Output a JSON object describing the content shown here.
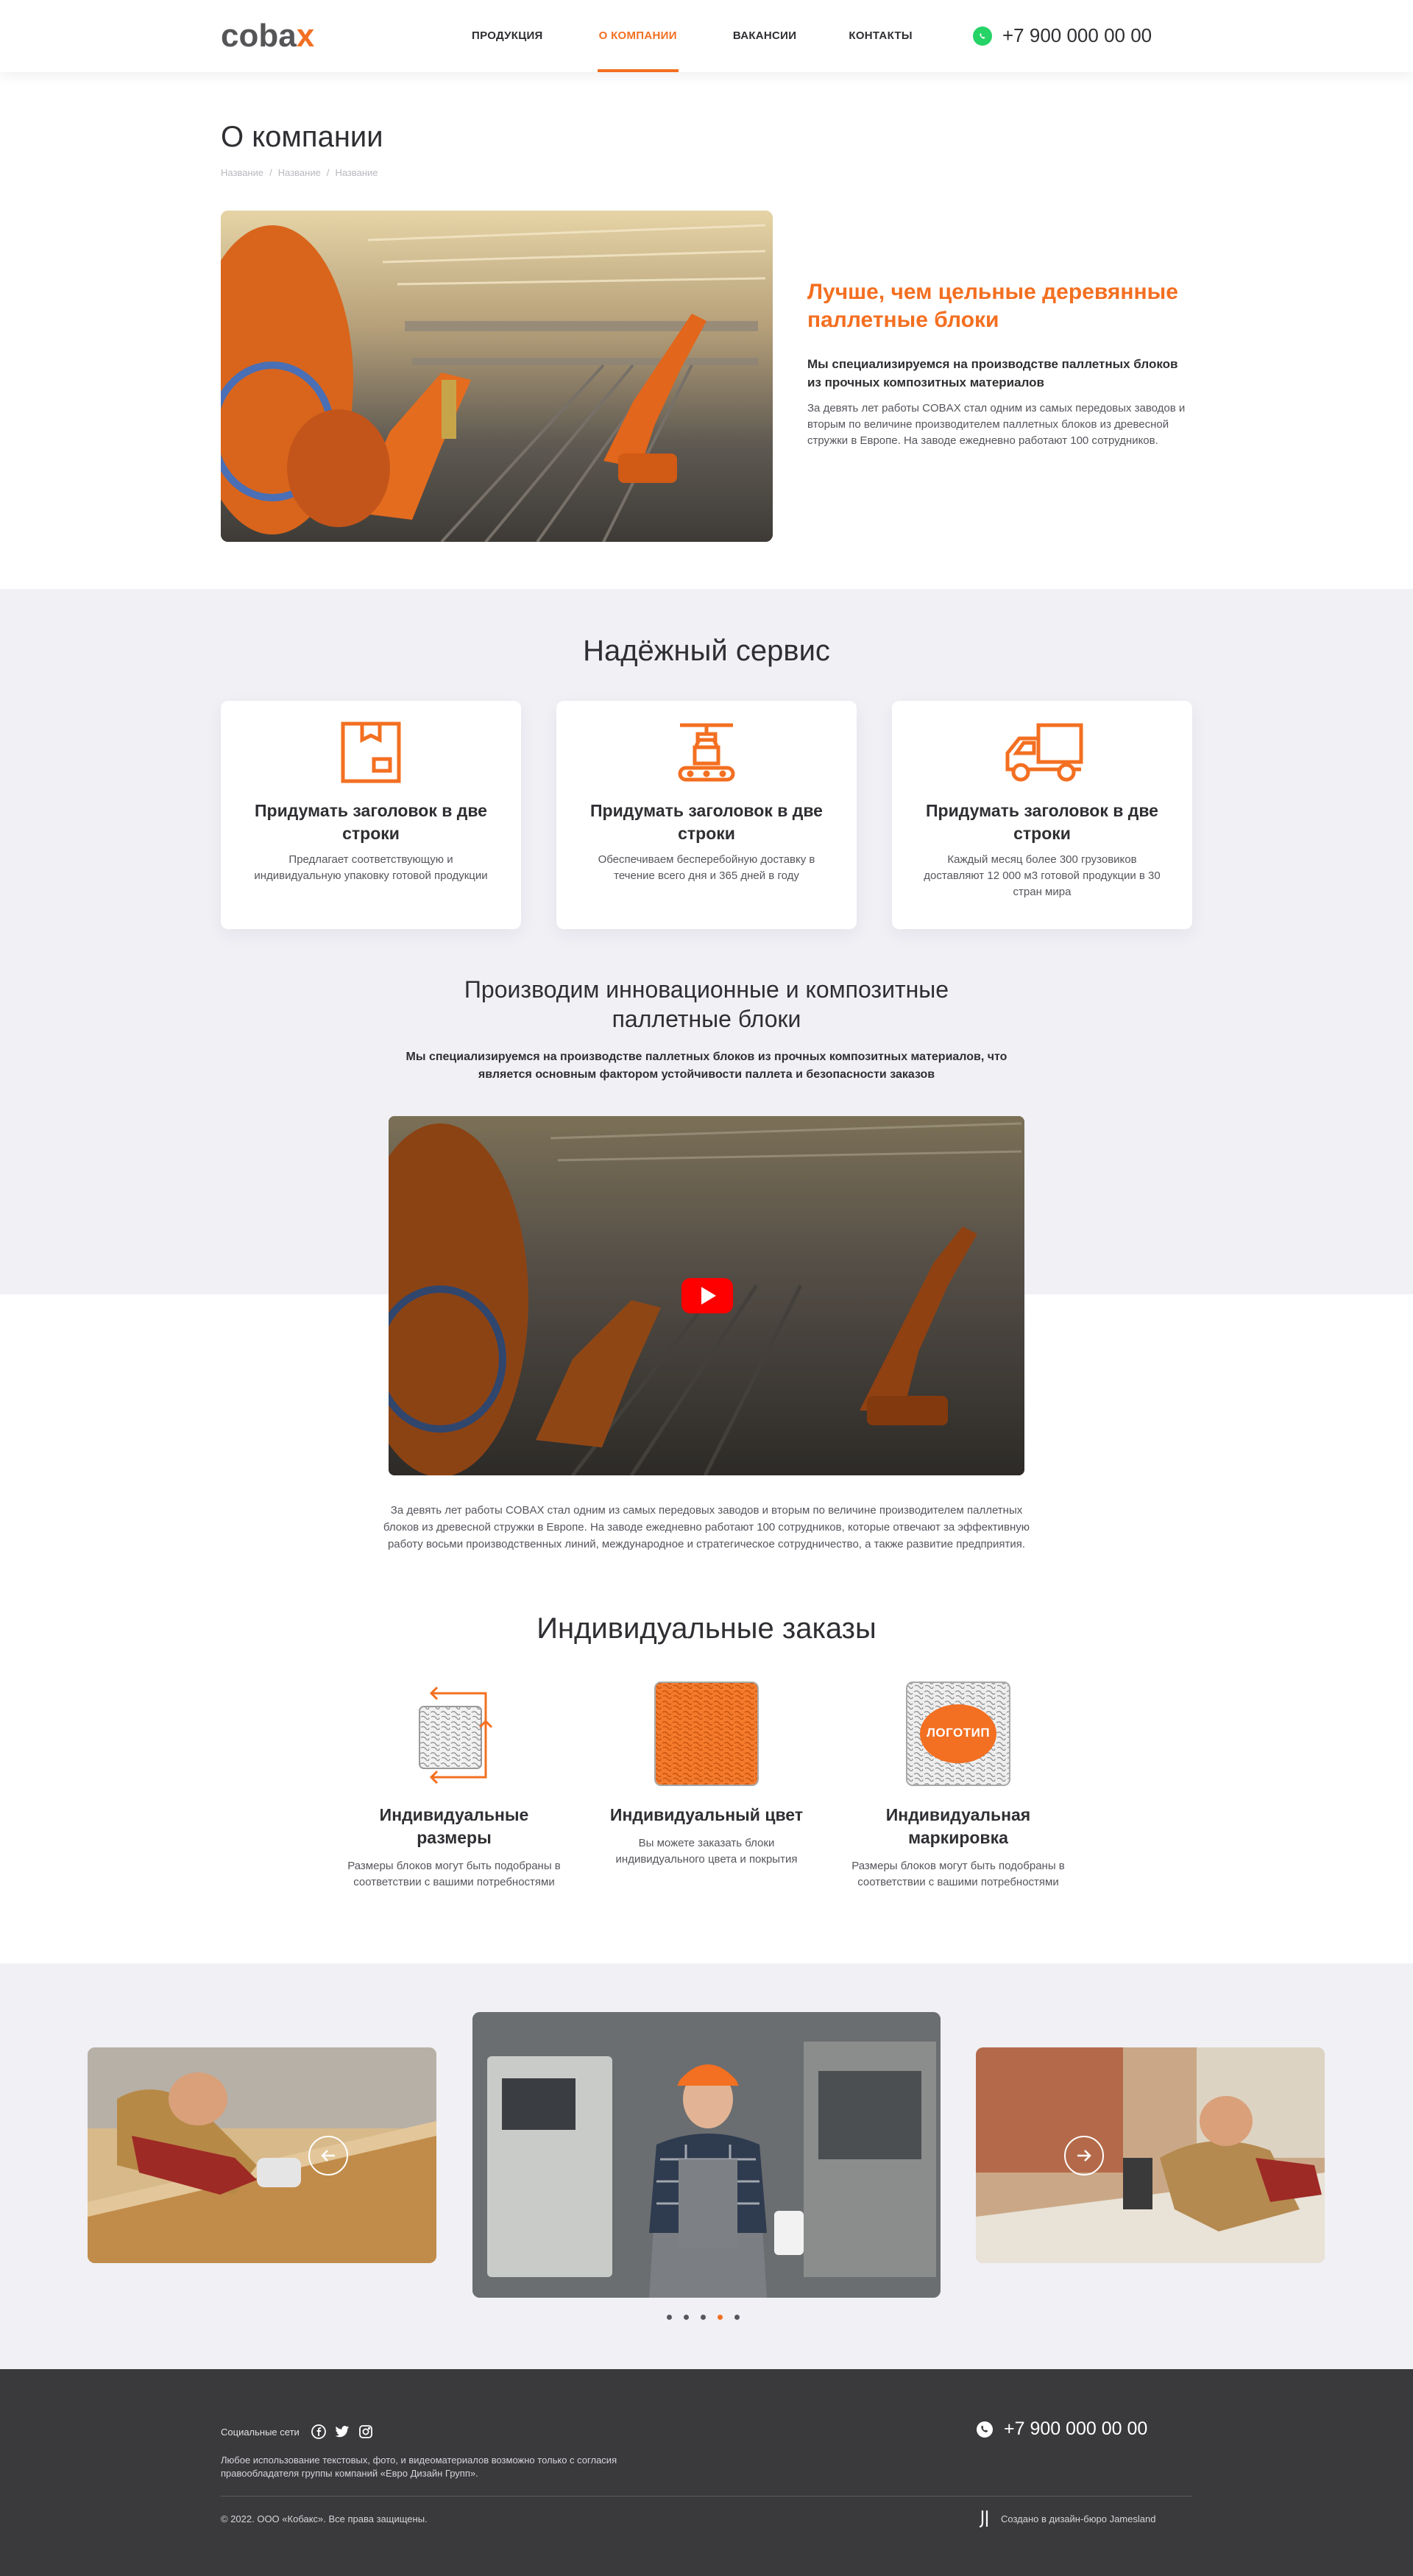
{
  "brand": {
    "logo_main": "coba",
    "logo_accent": "x",
    "accent": "#f36f21"
  },
  "nav": {
    "items": [
      {
        "label": "Продукция"
      },
      {
        "label": "О компании"
      },
      {
        "label": "Вакансии"
      },
      {
        "label": "Контакты"
      }
    ],
    "active_index": 1
  },
  "header": {
    "phone": "+7 900 000 00 00",
    "phone_icon": "whatsapp-icon"
  },
  "page": {
    "title": "О компании",
    "breadcrumb": [
      "Название",
      "Название",
      "Название"
    ]
  },
  "hero": {
    "heading": "Лучше, чем цельные деревянные паллетные блоки",
    "lead": "Мы специализируемся на производстве паллетных блоков из прочных композитных материалов",
    "text": "За девять лет работы COBAX стал одним из самых передовых заводов и вторым по величине производителем паллетных блоков из древесной стружки в Европе. На заводе ежедневно работают 100 сотрудников."
  },
  "service": {
    "title": "Надёжный сервис",
    "cards": [
      {
        "icon": "box-icon",
        "title": "Придумать заголовок в две строки",
        "text": "Предлагает соответствующую и индивидуальную упаковку готовой продукции"
      },
      {
        "icon": "conveyor-icon",
        "title": "Придумать заголовок в две строки",
        "text": "Обеспечиваем бесперебойную доставку в течение всего дня и 365 дней в году"
      },
      {
        "icon": "truck-icon",
        "title": "Придумать заголовок в две строки",
        "text": "Каждый месяц более 300 грузовиков доставляют 12 000 м3 готовой продукции в 30 стран мира"
      }
    ]
  },
  "innovation": {
    "title": "Производим инновационные и композитные паллетные блоки",
    "subtitle": "Мы специализируемся на производстве паллетных блоков из прочных композитных материалов, что является основным фактором устойчивости паллета и безопасности заказов",
    "video_icon": "youtube-play-icon",
    "text": "За девять лет работы COBAX стал одним из самых передовых заводов и вторым по величине производителем паллетных блоков из древесной стружки в Европе. На заводе ежедневно работают 100 сотрудников, которые отвечают за эффективную работу восьми производственных линий, международное и стратегическое сотрудничество, а также развитие предприятия."
  },
  "orders": {
    "title": "Индивидуальные заказы",
    "items": [
      {
        "title": "Индивидуальные размеры",
        "text": "Размеры блоков могут быть подобраны в соответствии с вашими потребностями"
      },
      {
        "title": "Индивидуальный цвет",
        "text": "Вы можете заказать блоки индивидуального цвета и покрытия"
      },
      {
        "title": "Индивидуальная маркировка",
        "text": "Размеры блоков могут быть подобраны в соответствии с вашими потребностями",
        "badge": "ЛОГОТИП"
      }
    ]
  },
  "carousel": {
    "slides": 5,
    "active_dot": 3
  },
  "footer": {
    "social_label": "Социальные сети",
    "social_icons": [
      "facebook-icon",
      "twitter-icon",
      "instagram-icon"
    ],
    "phone": "+7 900 000 00 00",
    "note": "Любое использование текстовых, фото, и видеоматериалов возможно только с согласия правообладателя группы компаний «Евро Дизайн Групп».",
    "copyright": "© 2022. ООО «Кобакс». Все права защищены.",
    "made_by": "Создано в дизайн-бюро Jamesland"
  }
}
